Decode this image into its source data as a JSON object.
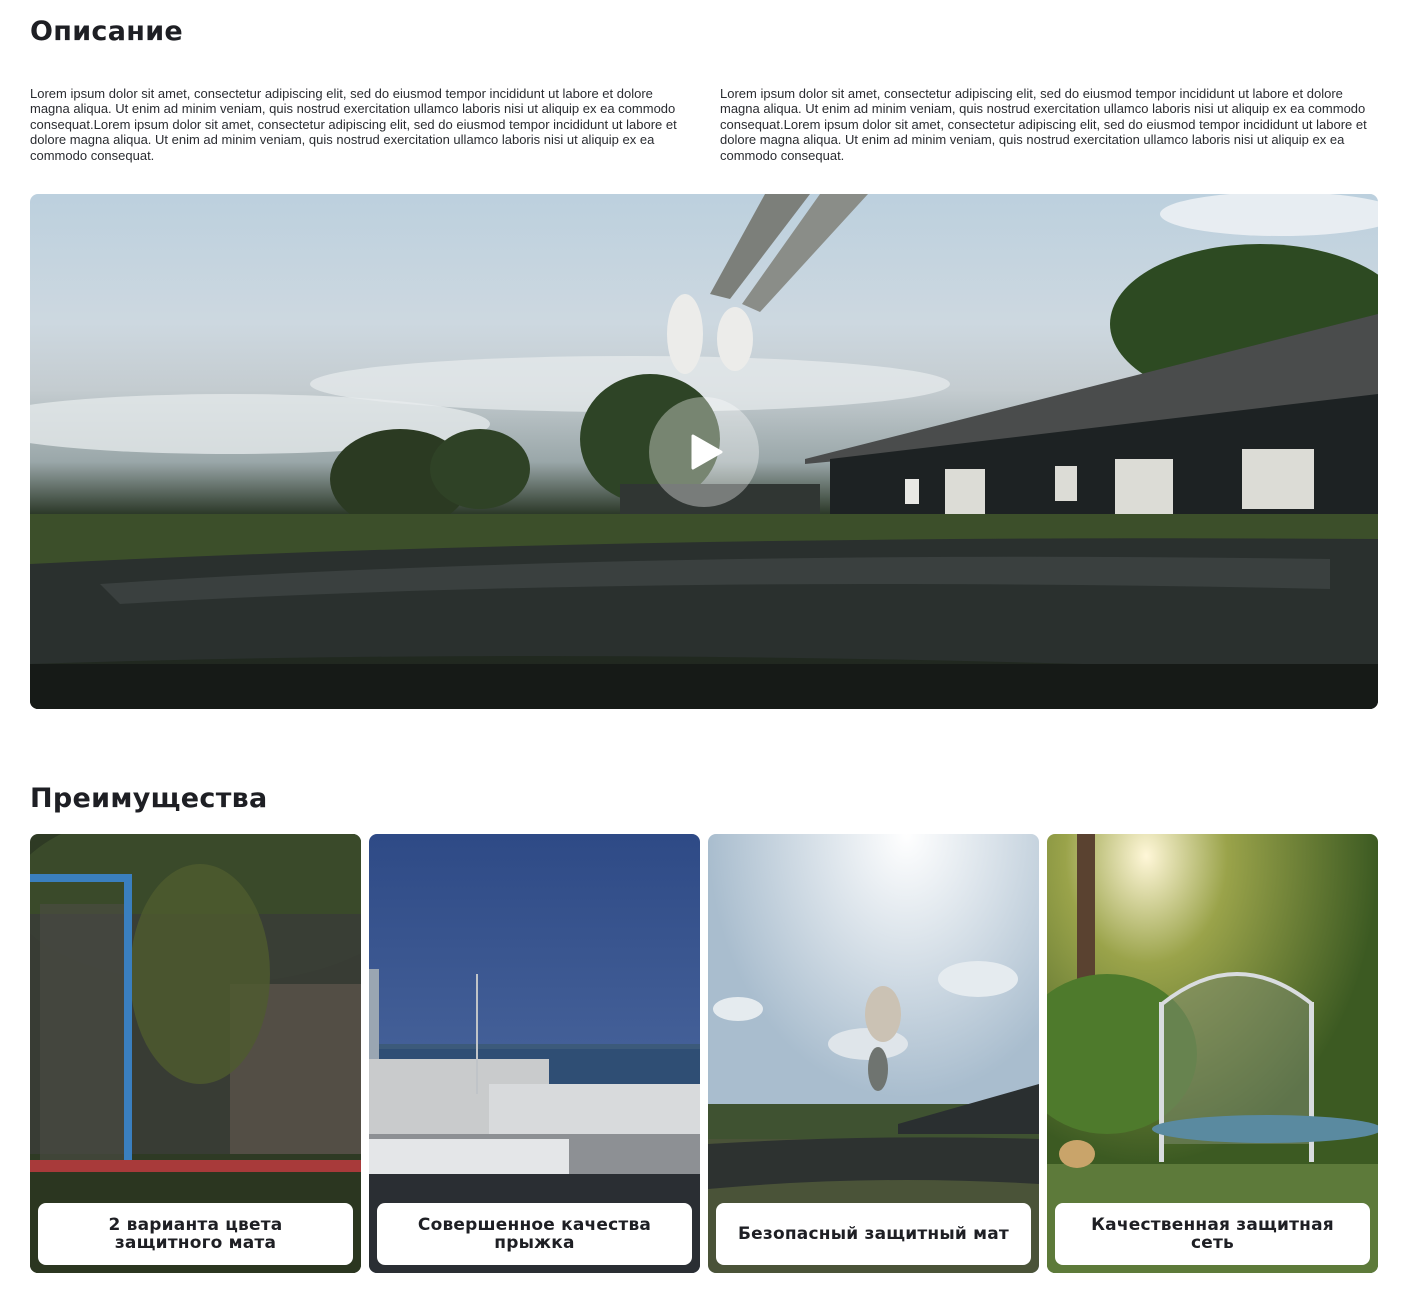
{
  "description": {
    "title": "Описание",
    "paragraphs": [
      "Lorem ipsum dolor sit amet, consectetur adipiscing elit, sed do eiusmod tempor incididunt ut labore et dolore magna aliqua. Ut enim ad minim veniam, quis nostrud exercitation ullamco laboris nisi ut aliquip ex ea commodo consequat.Lorem ipsum dolor sit amet, consectetur adipiscing elit, sed do eiusmod tempor incididunt ut labore et dolore magna aliqua. Ut enim ad minim veniam, quis nostrud exercitation ullamco laboris nisi ut aliquip ex ea commodo consequat.",
      "Lorem ipsum dolor sit amet, consectetur adipiscing elit, sed do eiusmod tempor incididunt ut labore et dolore magna aliqua. Ut enim ad minim veniam, quis nostrud exercitation ullamco laboris nisi ut aliquip ex ea commodo consequat.Lorem ipsum dolor sit amet, consectetur adipiscing elit, sed do eiusmod tempor incididunt ut labore et dolore magna aliqua. Ut enim ad minim veniam, quis nostrud exercitation ullamco laboris nisi ut aliquip ex ea commodo consequat."
    ]
  },
  "video": {
    "play_icon": "play-icon"
  },
  "advantages": {
    "title": "Преимущества",
    "cards": [
      {
        "label": "2 варианта цвета защитного мата"
      },
      {
        "label": "Совершенное качества прыжка"
      },
      {
        "label": "Безопасный защитный мат"
      },
      {
        "label": "Качественная защитная сеть"
      }
    ]
  },
  "colors": {
    "text": "#1e1f24",
    "background": "#ffffff",
    "label_background": "#ffffff"
  }
}
